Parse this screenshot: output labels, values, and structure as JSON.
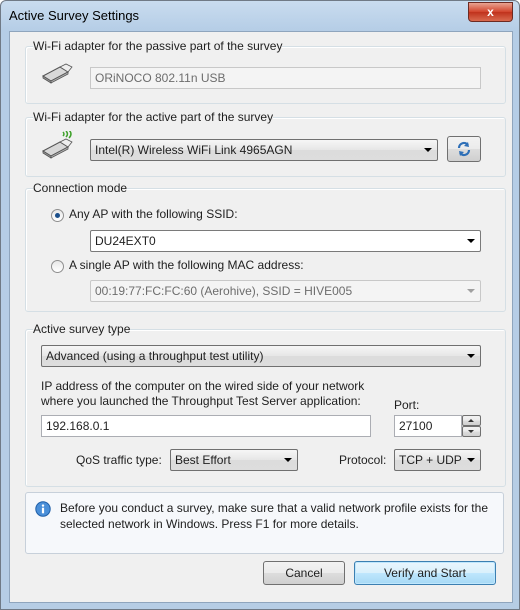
{
  "window": {
    "title": "Active Survey Settings",
    "close_glyph": "x"
  },
  "passive": {
    "group_label": "Wi-Fi adapter for the passive part of the survey",
    "adapter": "ORiNOCO 802.11n USB"
  },
  "active": {
    "group_label": "Wi-Fi adapter for the active part of the survey",
    "adapter": "Intel(R) Wireless WiFi Link 4965AGN"
  },
  "connection": {
    "group_label": "Connection mode",
    "option_ssid_label": "Any AP with the following SSID:",
    "ssid_value": "DU24EXT0",
    "option_mac_label": "A single AP with the following MAC address:",
    "mac_value": "00:19:77:FC:FC:60 (Aerohive), SSID = HIVE005",
    "selected": "ssid"
  },
  "survey": {
    "group_label": "Active survey type",
    "type_value": "Advanced (using a throughput test utility)",
    "ip_label_line1": "IP address of the computer on the wired side of your network",
    "ip_label_line2": "where you launched the Throughput Test Server application:",
    "ip_value": "192.168.0.1",
    "port_label": "Port:",
    "port_value": "27100",
    "qos_label": "QoS traffic type:",
    "qos_value": "Best Effort",
    "protocol_label": "Protocol:",
    "protocol_value": "TCP + UDP"
  },
  "info": {
    "text_line1": "Before you conduct a survey, make sure that a valid network profile exists for the",
    "text_line2": "selected network in Windows. Press F1 for more details."
  },
  "buttons": {
    "cancel": "Cancel",
    "verify": "Verify and Start"
  },
  "colors": {
    "accent": "#2e6fb7",
    "signal_green": "#3fa12b",
    "titlebar": "#c2d8ee"
  }
}
